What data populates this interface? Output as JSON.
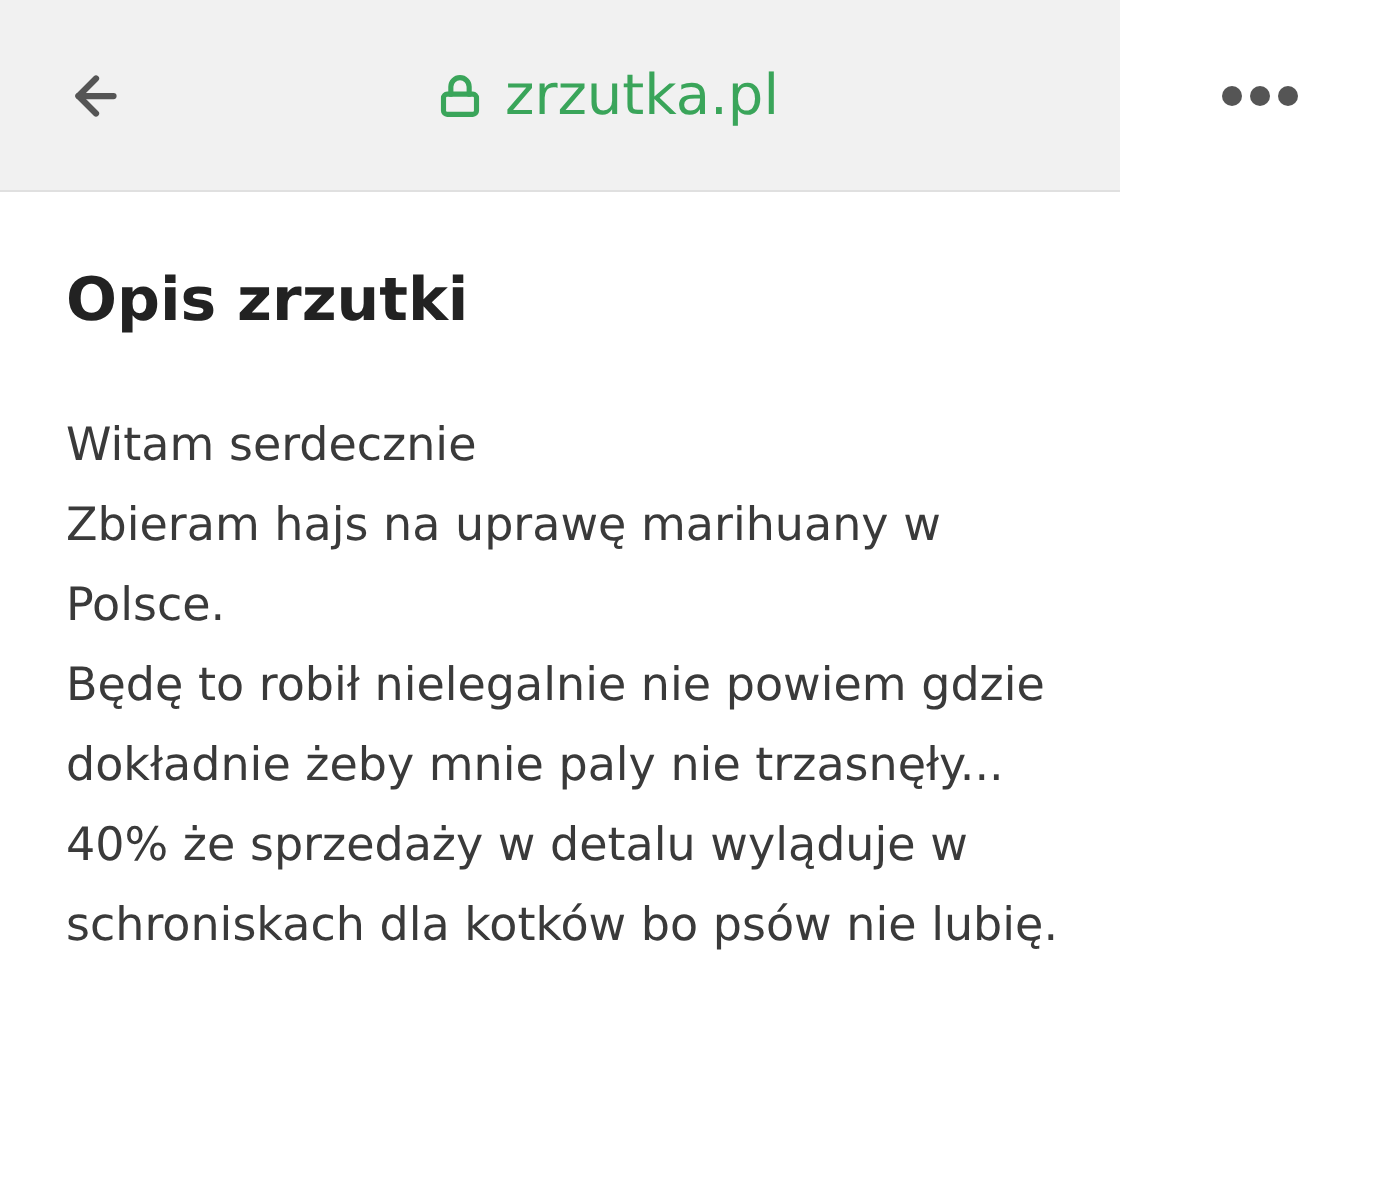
{
  "toolbar": {
    "address": "zrzutka.pl"
  },
  "heading": "Opis zrzutki",
  "paragraphs": [
    "Witam serdecznie",
    "Zbieram hajs na uprawę marihuany w Polsce.",
    "Będę to robił nielegalnie nie powiem gdzie dokładnie żeby mnie paly nie trzasnęły...",
    "40% że sprzedaży w detalu wyląduje w schroniskach dla kotków bo psów nie lubię."
  ]
}
